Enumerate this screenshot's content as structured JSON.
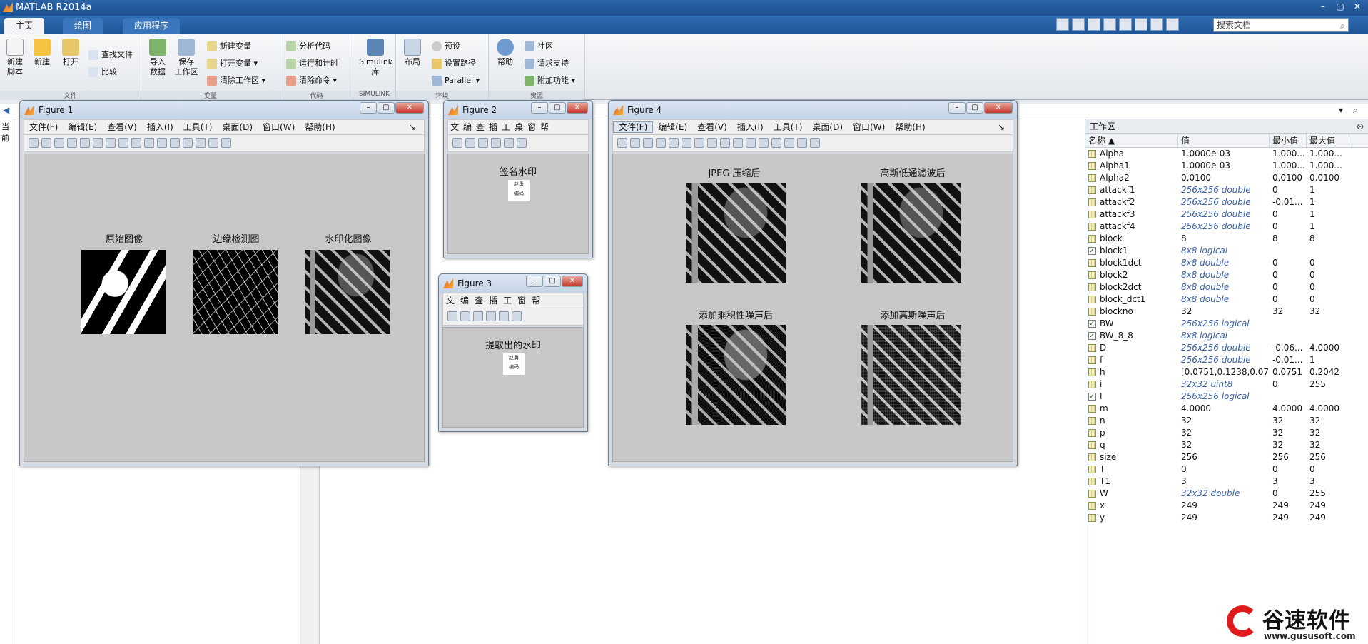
{
  "window": {
    "title": "MATLAB R2014a"
  },
  "tabs": [
    {
      "label": "主页",
      "active": true
    },
    {
      "label": "绘图",
      "active": false
    },
    {
      "label": "应用程序",
      "active": false
    }
  ],
  "search": {
    "placeholder": "搜索文档"
  },
  "ribbon": {
    "file_group": {
      "label": "文件",
      "new_script": "新建\n脚本",
      "new": "新建",
      "open": "打开",
      "find_files": "查找文件",
      "compare": "比较"
    },
    "var_group": {
      "label": "变量",
      "import": "导入\n数据",
      "save_ws": "保存\n工作区",
      "new_var": "新建变量",
      "open_var": "打开变量",
      "clear_ws": "清除工作区"
    },
    "code_group": {
      "label": "代码",
      "analyze": "分析代码",
      "run_time": "运行和计时",
      "clear_cmd": "清除命令"
    },
    "simulink_group": {
      "label": "SIMULINK",
      "simulink": "Simulink\n库"
    },
    "env_group": {
      "label": "环境",
      "layout": "布局",
      "prefs": "预设",
      "set_path": "设置路径",
      "parallel": "Parallel"
    },
    "res_group": {
      "label": "资源",
      "help": "帮助",
      "community": "社区",
      "request_support": "请求支持",
      "addons": "附加功能"
    }
  },
  "left_pane": {
    "label": "当前"
  },
  "figures": [
    {
      "title": "Figure 1",
      "menu": [
        "文件(F)",
        "编辑(E)",
        "查看(V)",
        "插入(I)",
        "工具(T)",
        "桌面(D)",
        "窗口(W)",
        "帮助(H)"
      ],
      "axes": [
        "原始图像",
        "边缘检测图",
        "水印化图像"
      ]
    },
    {
      "title": "Figure 2",
      "menu": [
        "文",
        "编",
        "查",
        "插",
        "工",
        "桌",
        "窗",
        "帮"
      ],
      "axes": [
        "签名水印"
      ],
      "watermark_text": [
        "赵勇",
        "编码"
      ]
    },
    {
      "title": "Figure 3",
      "menu": [
        "文",
        "编",
        "查",
        "插",
        "工",
        "窗",
        "帮"
      ],
      "axes": [
        "提取出的水印"
      ],
      "watermark_text": [
        "赵勇",
        "编码"
      ]
    },
    {
      "title": "Figure 4",
      "menu": [
        "文件(F)",
        "编辑(E)",
        "查看(V)",
        "插入(I)",
        "工具(T)",
        "桌面(D)",
        "窗口(W)",
        "帮助(H)"
      ],
      "axes": [
        "JPEG 压缩后",
        "高斯低通滤波后",
        "添加乘积性噪声后",
        "添加高斯噪声后"
      ]
    }
  ],
  "workspace": {
    "title": "工作区",
    "columns": [
      "名称 ▲",
      "值",
      "最小值",
      "最大值"
    ],
    "rows": [
      {
        "name": "Alpha",
        "value": "1.0000e-03",
        "min": "1.000...",
        "max": "1.000...",
        "type": "num"
      },
      {
        "name": "Alpha1",
        "value": "1.0000e-03",
        "min": "1.000...",
        "max": "1.000...",
        "type": "num"
      },
      {
        "name": "Alpha2",
        "value": "0.0100",
        "min": "0.0100",
        "max": "0.0100",
        "type": "num"
      },
      {
        "name": "attackf1",
        "value": "256x256 double",
        "min": "0",
        "max": "1",
        "type": "matrix"
      },
      {
        "name": "attackf2",
        "value": "256x256 double",
        "min": "-0.01...",
        "max": "1",
        "type": "matrix"
      },
      {
        "name": "attackf3",
        "value": "256x256 double",
        "min": "0",
        "max": "1",
        "type": "matrix"
      },
      {
        "name": "attackf4",
        "value": "256x256 double",
        "min": "0",
        "max": "1",
        "type": "matrix"
      },
      {
        "name": "block",
        "value": "8",
        "min": "8",
        "max": "8",
        "type": "num"
      },
      {
        "name": "block1",
        "value": "8x8 logical",
        "min": "",
        "max": "",
        "type": "logical"
      },
      {
        "name": "block1dct",
        "value": "8x8 double",
        "min": "0",
        "max": "0",
        "type": "matrix"
      },
      {
        "name": "block2",
        "value": "8x8 double",
        "min": "0",
        "max": "0",
        "type": "matrix"
      },
      {
        "name": "block2dct",
        "value": "8x8 double",
        "min": "0",
        "max": "0",
        "type": "matrix"
      },
      {
        "name": "block_dct1",
        "value": "8x8 double",
        "min": "0",
        "max": "0",
        "type": "matrix"
      },
      {
        "name": "blockno",
        "value": "32",
        "min": "32",
        "max": "32",
        "type": "num"
      },
      {
        "name": "BW",
        "value": "256x256 logical",
        "min": "",
        "max": "",
        "type": "logical"
      },
      {
        "name": "BW_8_8",
        "value": "8x8 logical",
        "min": "",
        "max": "",
        "type": "logical"
      },
      {
        "name": "D",
        "value": "256x256 double",
        "min": "-0.06...",
        "max": "4.0000",
        "type": "matrix"
      },
      {
        "name": "f",
        "value": "256x256 double",
        "min": "-0.01...",
        "max": "1",
        "type": "matrix"
      },
      {
        "name": "h",
        "value": "[0.0751,0.1238,0.07...",
        "min": "0.0751",
        "max": "0.2042",
        "type": "num"
      },
      {
        "name": "i",
        "value": "32x32 uint8",
        "min": "0",
        "max": "255",
        "type": "matrix"
      },
      {
        "name": "I",
        "value": "256x256 logical",
        "min": "",
        "max": "",
        "type": "logical"
      },
      {
        "name": "m",
        "value": "4.0000",
        "min": "4.0000",
        "max": "4.0000",
        "type": "num"
      },
      {
        "name": "n",
        "value": "32",
        "min": "32",
        "max": "32",
        "type": "num"
      },
      {
        "name": "p",
        "value": "32",
        "min": "32",
        "max": "32",
        "type": "num"
      },
      {
        "name": "q",
        "value": "32",
        "min": "32",
        "max": "32",
        "type": "num"
      },
      {
        "name": "size",
        "value": "256",
        "min": "256",
        "max": "256",
        "type": "num"
      },
      {
        "name": "T",
        "value": "0",
        "min": "0",
        "max": "0",
        "type": "num"
      },
      {
        "name": "T1",
        "value": "3",
        "min": "3",
        "max": "3",
        "type": "num"
      },
      {
        "name": "W",
        "value": "32x32 double",
        "min": "0",
        "max": "255",
        "type": "matrix"
      },
      {
        "name": "x",
        "value": "249",
        "min": "249",
        "max": "249",
        "type": "num"
      },
      {
        "name": "y",
        "value": "249",
        "min": "249",
        "max": "249",
        "type": "num"
      }
    ]
  },
  "watermark_logo": {
    "text": "谷速软件",
    "url": "www.gususoft.com"
  }
}
